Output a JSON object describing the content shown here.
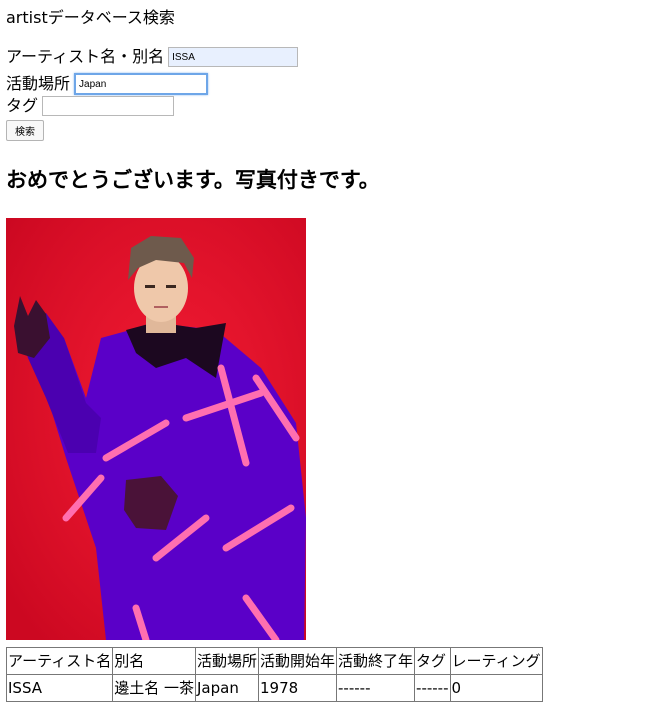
{
  "app_title": "artistデータベース検索",
  "form": {
    "name_label": "アーティスト名・別名",
    "name_value": "ISSA",
    "place_label": "活動場所",
    "place_value": "Japan",
    "tag_label": "タグ",
    "tag_value": "",
    "search_button": "検索"
  },
  "message": "おめでとうございます。写真付きです。",
  "results": {
    "headers": [
      "アーティスト名",
      "別名",
      "活動場所",
      "活動開始年",
      "活動終了年",
      "タグ",
      "レーティング"
    ],
    "rows": [
      [
        "ISSA",
        "邊土名 一茶",
        "Japan",
        "1978",
        "------",
        "------",
        "0"
      ]
    ]
  },
  "colors": {
    "photo_background": "#e8102a",
    "jacket": "#5a00c8",
    "jacket_stripes": "#ff6fb0"
  }
}
